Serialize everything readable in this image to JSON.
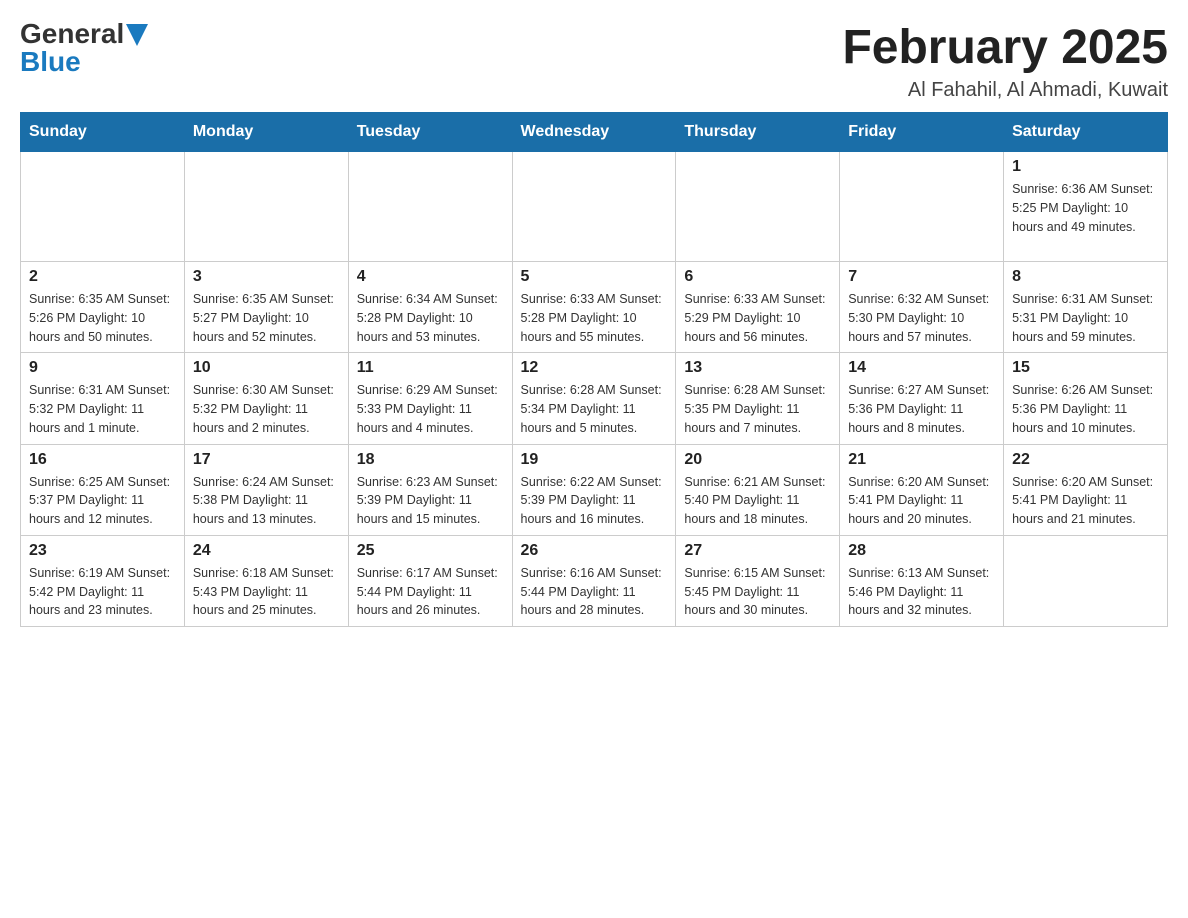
{
  "header": {
    "logo_general": "General",
    "logo_blue": "Blue",
    "title": "February 2025",
    "subtitle": "Al Fahahil, Al Ahmadi, Kuwait"
  },
  "weekdays": [
    "Sunday",
    "Monday",
    "Tuesday",
    "Wednesday",
    "Thursday",
    "Friday",
    "Saturday"
  ],
  "weeks": [
    [
      {
        "day": "",
        "info": ""
      },
      {
        "day": "",
        "info": ""
      },
      {
        "day": "",
        "info": ""
      },
      {
        "day": "",
        "info": ""
      },
      {
        "day": "",
        "info": ""
      },
      {
        "day": "",
        "info": ""
      },
      {
        "day": "1",
        "info": "Sunrise: 6:36 AM\nSunset: 5:25 PM\nDaylight: 10 hours and 49 minutes."
      }
    ],
    [
      {
        "day": "2",
        "info": "Sunrise: 6:35 AM\nSunset: 5:26 PM\nDaylight: 10 hours and 50 minutes."
      },
      {
        "day": "3",
        "info": "Sunrise: 6:35 AM\nSunset: 5:27 PM\nDaylight: 10 hours and 52 minutes."
      },
      {
        "day": "4",
        "info": "Sunrise: 6:34 AM\nSunset: 5:28 PM\nDaylight: 10 hours and 53 minutes."
      },
      {
        "day": "5",
        "info": "Sunrise: 6:33 AM\nSunset: 5:28 PM\nDaylight: 10 hours and 55 minutes."
      },
      {
        "day": "6",
        "info": "Sunrise: 6:33 AM\nSunset: 5:29 PM\nDaylight: 10 hours and 56 minutes."
      },
      {
        "day": "7",
        "info": "Sunrise: 6:32 AM\nSunset: 5:30 PM\nDaylight: 10 hours and 57 minutes."
      },
      {
        "day": "8",
        "info": "Sunrise: 6:31 AM\nSunset: 5:31 PM\nDaylight: 10 hours and 59 minutes."
      }
    ],
    [
      {
        "day": "9",
        "info": "Sunrise: 6:31 AM\nSunset: 5:32 PM\nDaylight: 11 hours and 1 minute."
      },
      {
        "day": "10",
        "info": "Sunrise: 6:30 AM\nSunset: 5:32 PM\nDaylight: 11 hours and 2 minutes."
      },
      {
        "day": "11",
        "info": "Sunrise: 6:29 AM\nSunset: 5:33 PM\nDaylight: 11 hours and 4 minutes."
      },
      {
        "day": "12",
        "info": "Sunrise: 6:28 AM\nSunset: 5:34 PM\nDaylight: 11 hours and 5 minutes."
      },
      {
        "day": "13",
        "info": "Sunrise: 6:28 AM\nSunset: 5:35 PM\nDaylight: 11 hours and 7 minutes."
      },
      {
        "day": "14",
        "info": "Sunrise: 6:27 AM\nSunset: 5:36 PM\nDaylight: 11 hours and 8 minutes."
      },
      {
        "day": "15",
        "info": "Sunrise: 6:26 AM\nSunset: 5:36 PM\nDaylight: 11 hours and 10 minutes."
      }
    ],
    [
      {
        "day": "16",
        "info": "Sunrise: 6:25 AM\nSunset: 5:37 PM\nDaylight: 11 hours and 12 minutes."
      },
      {
        "day": "17",
        "info": "Sunrise: 6:24 AM\nSunset: 5:38 PM\nDaylight: 11 hours and 13 minutes."
      },
      {
        "day": "18",
        "info": "Sunrise: 6:23 AM\nSunset: 5:39 PM\nDaylight: 11 hours and 15 minutes."
      },
      {
        "day": "19",
        "info": "Sunrise: 6:22 AM\nSunset: 5:39 PM\nDaylight: 11 hours and 16 minutes."
      },
      {
        "day": "20",
        "info": "Sunrise: 6:21 AM\nSunset: 5:40 PM\nDaylight: 11 hours and 18 minutes."
      },
      {
        "day": "21",
        "info": "Sunrise: 6:20 AM\nSunset: 5:41 PM\nDaylight: 11 hours and 20 minutes."
      },
      {
        "day": "22",
        "info": "Sunrise: 6:20 AM\nSunset: 5:41 PM\nDaylight: 11 hours and 21 minutes."
      }
    ],
    [
      {
        "day": "23",
        "info": "Sunrise: 6:19 AM\nSunset: 5:42 PM\nDaylight: 11 hours and 23 minutes."
      },
      {
        "day": "24",
        "info": "Sunrise: 6:18 AM\nSunset: 5:43 PM\nDaylight: 11 hours and 25 minutes."
      },
      {
        "day": "25",
        "info": "Sunrise: 6:17 AM\nSunset: 5:44 PM\nDaylight: 11 hours and 26 minutes."
      },
      {
        "day": "26",
        "info": "Sunrise: 6:16 AM\nSunset: 5:44 PM\nDaylight: 11 hours and 28 minutes."
      },
      {
        "day": "27",
        "info": "Sunrise: 6:15 AM\nSunset: 5:45 PM\nDaylight: 11 hours and 30 minutes."
      },
      {
        "day": "28",
        "info": "Sunrise: 6:13 AM\nSunset: 5:46 PM\nDaylight: 11 hours and 32 minutes."
      },
      {
        "day": "",
        "info": ""
      }
    ]
  ]
}
